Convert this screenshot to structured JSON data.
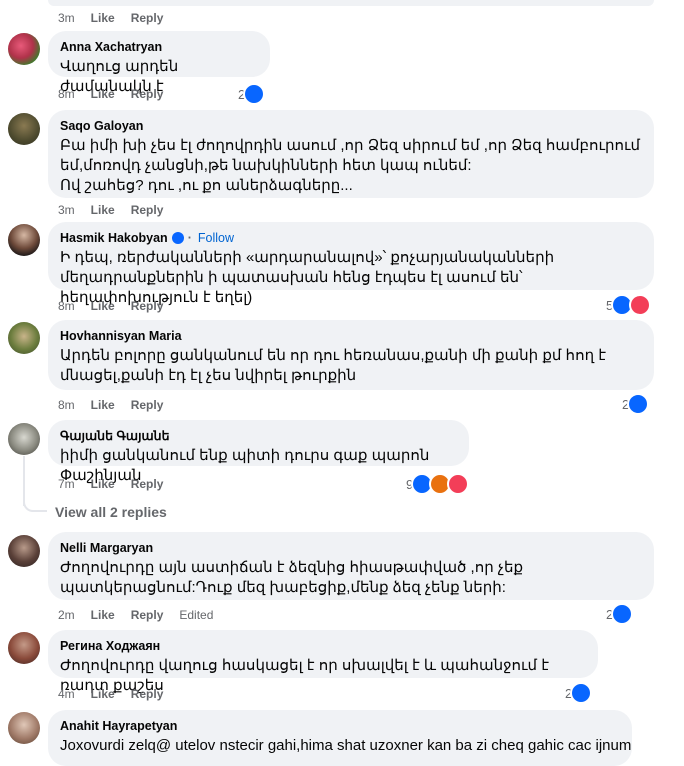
{
  "top_meta": {
    "time": "3m",
    "like": "Like",
    "reply": "Reply"
  },
  "comments": [
    {
      "name": "Anna Xachatryan",
      "text": "Վաղուց արդեն ժամանակն է",
      "time": "8m",
      "like": "Like",
      "reply": "Reply",
      "reactions": "2"
    },
    {
      "name": "Saqo Galoyan",
      "text": "Բա իմի խի չես էլ ժողովրդին ասում ,որ Ձեզ սիրում եմ ,որ Ձեզ համբուրում եմ,մոռովդ չանցնի,թե նախկինների հետ կապ ունեմ:\nՈվ շահեց? դու ,ու քո աներձագները...",
      "time": "3m",
      "like": "Like",
      "reply": "Reply",
      "reactions": ""
    },
    {
      "name": "Hasmik Hakobyan",
      "follow": "Follow",
      "text": "Ի դեպ, ռերժականների «արդարանալով»՝ քոչարյանականների մեղադրանքներին ի պատասխան հենց էդպես էլ ասում են՝ հեղափոխություն է եղել)",
      "time": "8m",
      "like": "Like",
      "reply": "Reply",
      "reactions": "5"
    },
    {
      "name": "Hovhannisyan Maria",
      "text": "Արդեն բոլորը ցանկանում են որ դու հեռանաս,քանի մի քանի քմ հող է մնացել,քանի էդ էլ չես նվիրել թուրքին",
      "time": "8m",
      "like": "Like",
      "reply": "Reply",
      "reactions": "2"
    },
    {
      "name": "Գայանե Գայանե",
      "text": "իիմի ցանկանում ենք պիտի դուրս գաք պարոն Փաշինյան",
      "time": "7m",
      "like": "Like",
      "reply": "Reply",
      "reactions": "9"
    },
    {
      "name": "Nelli Margaryan",
      "text": "Ժողովուրդը այն աստիճան է ձեզնից հիասթափված ,որ չեք պատկերացնում:Դուք մեզ խաբեցիք,մենք ձեզ չենք ների:",
      "time": "2m",
      "like": "Like",
      "reply": "Reply",
      "edited": "Edited",
      "reactions": "2"
    },
    {
      "name": "Регина Ходжаян",
      "text": "Ժողովուրդը վաղուց հասկացել է որ սխալվել է և պահանջում է ռադտ քաշես",
      "time": "4m",
      "like": "Like",
      "reply": "Reply",
      "reactions": "2"
    },
    {
      "name": "Anahit Hayrapetyan",
      "text": "Joxovurdi zelq@ utelov nstecir gahi,hima shat uzoxner kan ba zi cheq gahic cac ijnum",
      "time": "",
      "like": "",
      "reply": "",
      "reactions": ""
    }
  ],
  "view_replies": "View all 2 replies",
  "colors": {
    "like": "#0866ff",
    "love": "#f33e58",
    "angry": "#e9710f",
    "bubble": "#f0f2f5",
    "meta": "#65676b"
  }
}
